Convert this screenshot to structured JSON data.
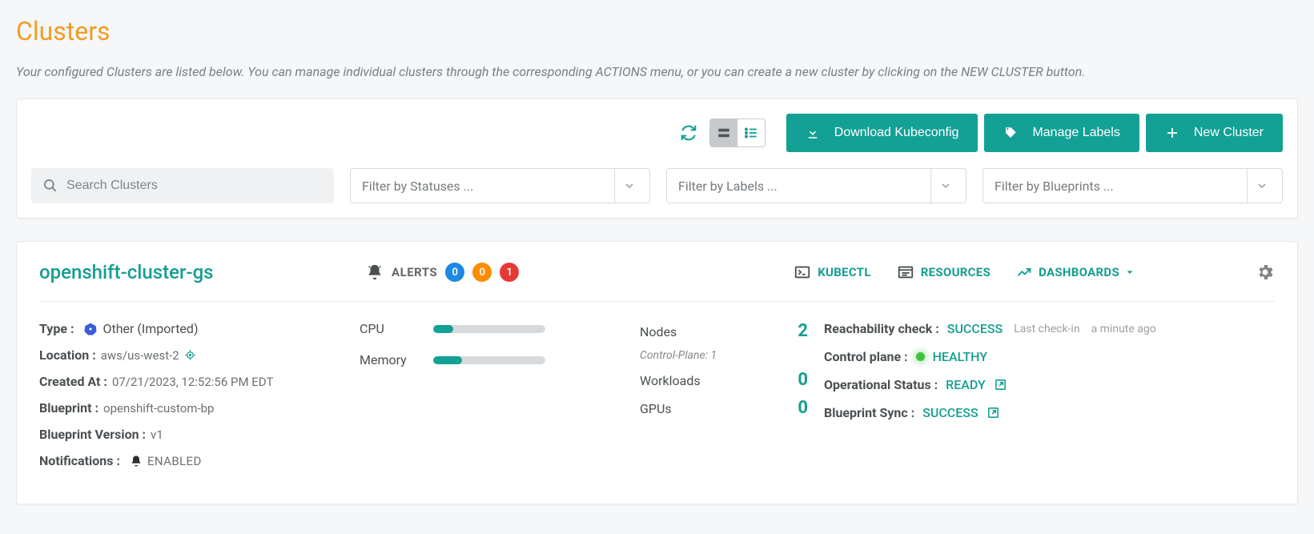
{
  "page": {
    "title": "Clusters",
    "description": "Your configured Clusters are listed below. You can manage individual clusters through the corresponding ACTIONS menu, or you can create a new cluster by clicking on the NEW CLUSTER button."
  },
  "toolbar": {
    "download_label": "Download Kubeconfig",
    "manage_labels_label": "Manage Labels",
    "new_cluster_label": "New Cluster",
    "search_placeholder": "Search Clusters",
    "filter_status_placeholder": "Filter by Statuses ...",
    "filter_labels_placeholder": "Filter by Labels ...",
    "filter_blueprints_placeholder": "Filter by Blueprints ..."
  },
  "cluster": {
    "name": "openshift-cluster-gs",
    "alerts": {
      "label": "ALERTS",
      "info": "0",
      "warn": "0",
      "error": "1"
    },
    "header_links": {
      "kubectl": "KUBECTL",
      "resources": "RESOURCES",
      "dashboards": "DASHBOARDS"
    },
    "meta": {
      "type_key": "Type :",
      "type_val": "Other (Imported)",
      "location_key": "Location :",
      "location_val": "aws/us-west-2",
      "created_key": "Created At :",
      "created_val": "07/21/2023, 12:52:56 PM EDT",
      "blueprint_key": "Blueprint :",
      "blueprint_val": "openshift-custom-bp",
      "bp_version_key": "Blueprint Version :",
      "bp_version_val": "v1",
      "notifications_key": "Notifications :",
      "notifications_val": "ENABLED"
    },
    "bars": {
      "cpu_label": "CPU",
      "cpu_pct": 18,
      "mem_label": "Memory",
      "mem_pct": 26
    },
    "counts": {
      "nodes_label": "Nodes",
      "nodes_val": "2",
      "control_plane_label": "Control-Plane: 1",
      "workloads_label": "Workloads",
      "workloads_val": "0",
      "gpus_label": "GPUs",
      "gpus_val": "0"
    },
    "status": {
      "reachability_key": "Reachability check :",
      "reachability_val": "SUCCESS",
      "reachability_hint_pre": "Last check-in",
      "reachability_hint_time": "a minute ago",
      "control_plane_key": "Control plane :",
      "control_plane_val": "HEALTHY",
      "op_status_key": "Operational Status :",
      "op_status_val": "READY",
      "bp_sync_key": "Blueprint Sync :",
      "bp_sync_val": "SUCCESS"
    }
  }
}
